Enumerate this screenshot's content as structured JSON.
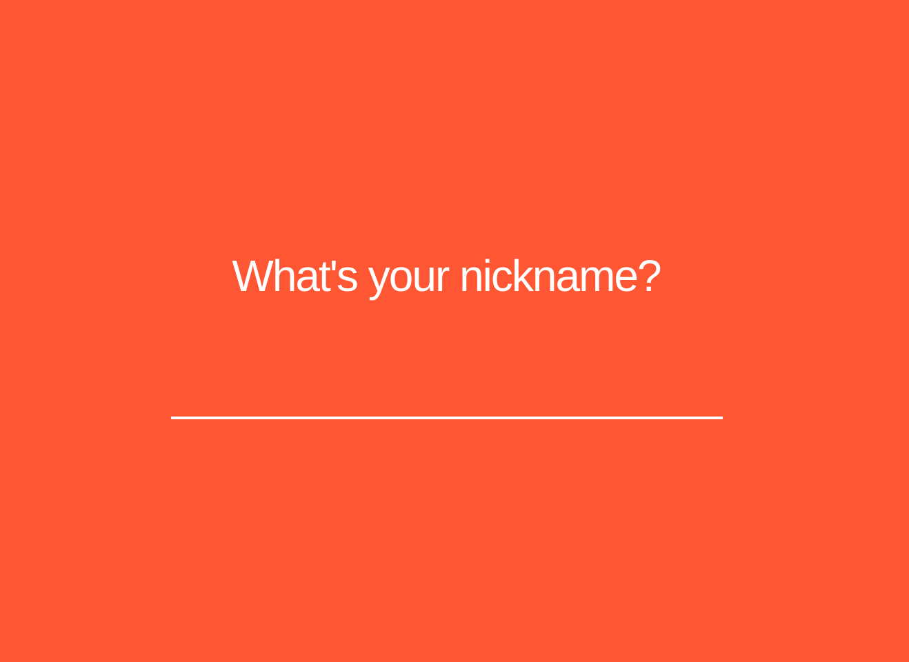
{
  "prompt": {
    "question": "What's your nickname?"
  },
  "nickname_field": {
    "value": "",
    "placeholder": ""
  },
  "colors": {
    "background": "#ff5733",
    "foreground": "#ffffff"
  }
}
